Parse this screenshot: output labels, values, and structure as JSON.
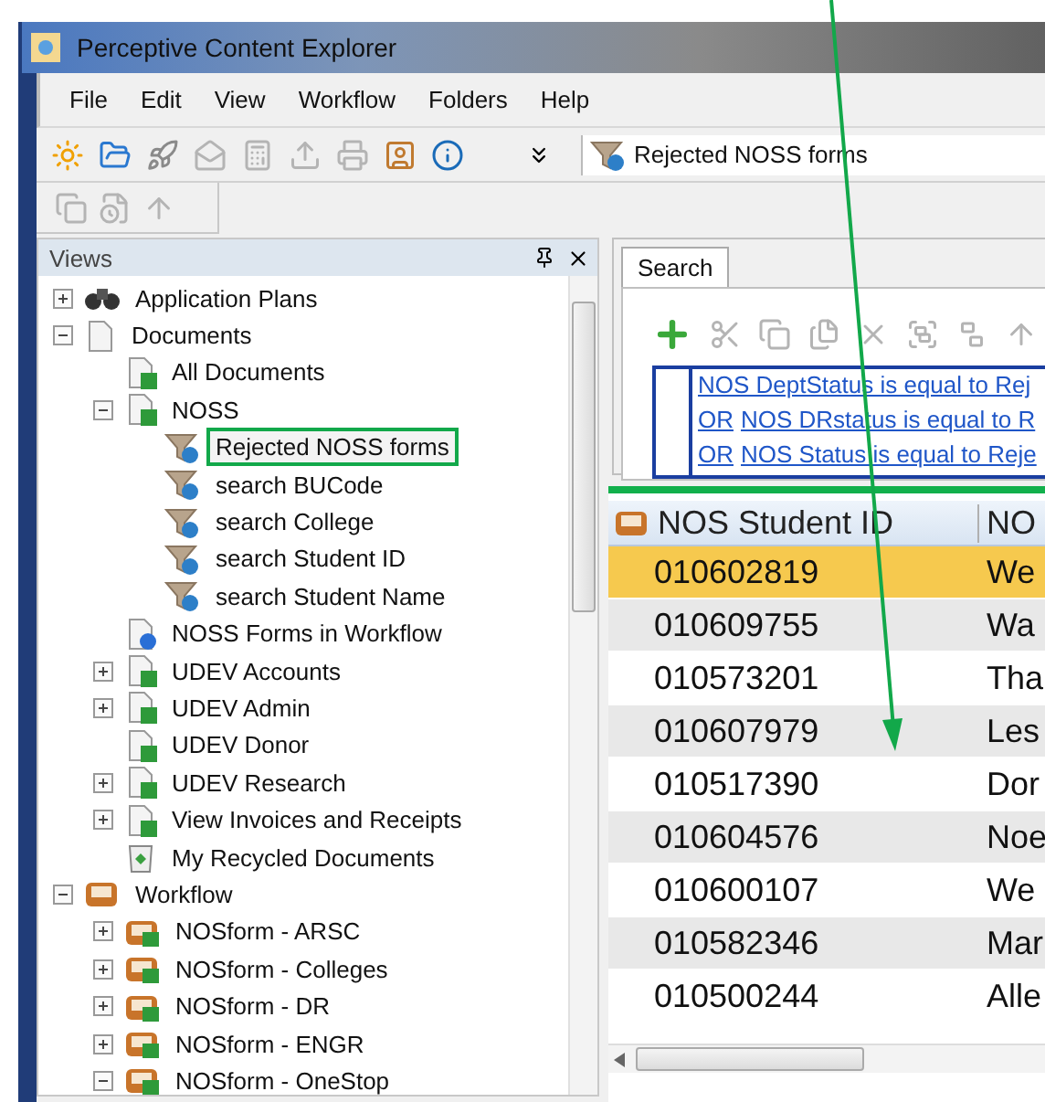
{
  "window": {
    "title": "Perceptive Content Explorer"
  },
  "menu": [
    {
      "label": "File"
    },
    {
      "label": "Edit"
    },
    {
      "label": "View"
    },
    {
      "label": "Workflow"
    },
    {
      "label": "Folders"
    },
    {
      "label": "Help"
    }
  ],
  "toolbar": {
    "buttons": [
      {
        "kind": "sun",
        "disabled": false
      },
      {
        "kind": "folder",
        "disabled": false
      },
      {
        "kind": "rocket",
        "disabled": false
      },
      {
        "kind": "mail",
        "disabled": true
      },
      {
        "kind": "fax",
        "disabled": true
      },
      {
        "kind": "upload",
        "disabled": true
      },
      {
        "kind": "printer",
        "disabled": true
      },
      {
        "kind": "user",
        "disabled": false
      },
      {
        "kind": "info",
        "disabled": false
      }
    ],
    "view_field": {
      "value": "Rejected NOSS forms"
    }
  },
  "toolbar_2": {
    "buttons": [
      {
        "kind": "copy",
        "disabled": true
      },
      {
        "kind": "clock",
        "disabled": true
      },
      {
        "kind": "up",
        "disabled": true
      }
    ]
  },
  "views_panel": {
    "title": "Views",
    "tree": [
      {
        "label": "Application Plans",
        "kind": "binoculars",
        "expandable": true,
        "expanded": false,
        "annotated": false
      },
      {
        "label": "Documents",
        "kind": "document",
        "expandable": true,
        "expanded": true,
        "annotated": false,
        "children": [
          {
            "label": "All Documents",
            "kind": "view",
            "expandable": false,
            "annotated": false
          },
          {
            "label": "NOSS",
            "kind": "view",
            "expandable": true,
            "expanded": true,
            "annotated": false,
            "children": [
              {
                "label": "Rejected NOSS forms",
                "kind": "filter",
                "expandable": false,
                "annotated": true
              },
              {
                "label": "search BUCode",
                "kind": "filter",
                "expandable": false,
                "annotated": false
              },
              {
                "label": "search College",
                "kind": "filter",
                "expandable": false,
                "annotated": false
              },
              {
                "label": "search Student ID",
                "kind": "filter",
                "expandable": false,
                "annotated": false
              },
              {
                "label": "search Student Name",
                "kind": "filter",
                "expandable": false,
                "annotated": false
              }
            ]
          },
          {
            "label": "NOSS Forms in Workflow",
            "kind": "workflow-view",
            "expandable": false,
            "annotated": false
          },
          {
            "label": "UDEV Accounts",
            "kind": "view",
            "expandable": true,
            "expanded": false,
            "annotated": false
          },
          {
            "label": "UDEV Admin",
            "kind": "view",
            "expandable": true,
            "expanded": false,
            "annotated": false
          },
          {
            "label": "UDEV Donor",
            "kind": "view",
            "expandable": false,
            "annotated": false
          },
          {
            "label": "UDEV Research",
            "kind": "view",
            "expandable": true,
            "expanded": false,
            "annotated": false
          },
          {
            "label": "View Invoices and Receipts",
            "kind": "view",
            "expandable": true,
            "expanded": false,
            "annotated": false
          },
          {
            "label": "My Recycled Documents",
            "kind": "recycle",
            "expandable": false,
            "annotated": false
          }
        ]
      },
      {
        "label": "Workflow",
        "kind": "inbox",
        "expandable": true,
        "expanded": true,
        "annotated": false,
        "children": [
          {
            "label": "NOSform - ARSC",
            "kind": "queue",
            "expandable": true,
            "expanded": false,
            "annotated": false
          },
          {
            "label": "NOSform - Colleges",
            "kind": "queue",
            "expandable": true,
            "expanded": false,
            "annotated": false
          },
          {
            "label": "NOSform - DR",
            "kind": "queue",
            "expandable": true,
            "expanded": false,
            "annotated": false
          },
          {
            "label": "NOSform - ENGR",
            "kind": "queue",
            "expandable": true,
            "expanded": false,
            "annotated": false
          },
          {
            "label": "NOSform - OneStop",
            "kind": "queue",
            "expandable": true,
            "expanded": true,
            "annotated": false
          }
        ]
      }
    ]
  },
  "search_panel": {
    "tabs": [
      {
        "label": "Search",
        "selected": true
      }
    ],
    "toolbar": {
      "buttons": [
        {
          "kind": "add",
          "disabled": false
        },
        {
          "kind": "cut",
          "disabled": true
        },
        {
          "kind": "copy",
          "disabled": true
        },
        {
          "kind": "paste",
          "disabled": true
        },
        {
          "kind": "delete",
          "disabled": true
        },
        {
          "kind": "group",
          "disabled": true
        },
        {
          "kind": "ungroup",
          "disabled": true
        },
        {
          "kind": "up",
          "disabled": true
        }
      ]
    },
    "criteria": [
      {
        "text": "NOS DeptStatus is equal to Rej"
      },
      {
        "operator": "OR",
        "text": "NOS DRstatus is equal to R"
      },
      {
        "operator": "OR",
        "text": "NOS Status is equal to Reje"
      }
    ]
  },
  "results": {
    "annotated": true,
    "columns": [
      "NOS Student ID",
      "NO"
    ],
    "rows": [
      {
        "cells": [
          "010602819",
          "We"
        ],
        "selected": true,
        "marked": false
      },
      {
        "cells": [
          "010609755",
          "Wa"
        ],
        "selected": false,
        "marked": false
      },
      {
        "cells": [
          "010573201",
          "Tha"
        ],
        "selected": false,
        "marked": false
      },
      {
        "cells": [
          "010607979",
          "Les"
        ],
        "selected": false,
        "marked": false
      },
      {
        "cells": [
          "010517390",
          "Dor"
        ],
        "selected": false,
        "marked": false
      },
      {
        "cells": [
          "010604576",
          "Noe"
        ],
        "selected": false,
        "marked": false
      },
      {
        "cells": [
          "010600107",
          "We"
        ],
        "selected": false,
        "marked": false
      },
      {
        "cells": [
          "010582346",
          "Mar"
        ],
        "selected": false,
        "marked": false
      },
      {
        "cells": [
          "010500244",
          "Alle"
        ],
        "selected": false,
        "marked": false
      }
    ]
  }
}
